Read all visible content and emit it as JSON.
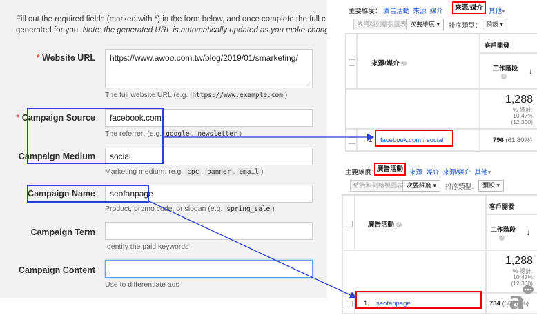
{
  "form": {
    "intro_line1": "Fill out the required fields (marked with *) in the form below, and once complete the full c",
    "intro_line2_a": "generated for you. ",
    "intro_line2_note": "Note: the generated URL is automatically updated as you make change",
    "required_mark": "*",
    "website_url": {
      "label": "Website URL",
      "value": "https://www.awoo.com.tw/blog/2019/01/smarketing/",
      "hint_prefix": "The full website URL (e.g. ",
      "hint_code": "https://www.example.com",
      "hint_suffix": ")"
    },
    "campaign_source": {
      "label": "Campaign Source",
      "value": "facebook.com",
      "hint_prefix": "The referrer: (e.g. ",
      "hint_code1": "google",
      "hint_sep": ", ",
      "hint_code2": "newsletter",
      "hint_suffix": ")"
    },
    "campaign_medium": {
      "label": "Campaign Medium",
      "value": "social",
      "hint_prefix": "Marketing medium: (e.g. ",
      "hint_code1": "cpc",
      "hint_code2": "banner",
      "hint_code3": "email",
      "hint_sep": ", ",
      "hint_suffix": ")"
    },
    "campaign_name": {
      "label": "Campaign Name",
      "value": "seofanpage",
      "hint_prefix": "Product, promo code, or slogan (e.g. ",
      "hint_code": "spring_sale",
      "hint_suffix": ")"
    },
    "campaign_term": {
      "label": "Campaign Term",
      "value": "",
      "hint": "Identify the paid keywords"
    },
    "campaign_content": {
      "label": "Campaign Content",
      "value": "",
      "hint": "Use to differentiate ads"
    }
  },
  "ga_top": {
    "primary_dim_label": "主要維度：",
    "dims": [
      "廣告活動",
      "來源",
      "媒介",
      "來源/媒介",
      "其他"
    ],
    "active_dim": "來源/媒介",
    "other_caret": "▾",
    "plot_rows": "依資料列繪製圖表",
    "secondary_dim": "次要維度",
    "caret": "▾",
    "sort_type_label": "排序類型：",
    "sort_default": "預設",
    "column_header": "來源/媒介",
    "metric_group": "客戶開發",
    "metric_name": "工作階段",
    "sort_arrow": "↓",
    "total_value": "1,288",
    "total_pct_label": "% 總計:",
    "total_pct": "10.47%",
    "total_paren": "(12,300)",
    "row_index": "1.",
    "row_label": "facebook.com / social",
    "row_value": "796",
    "row_pct": "(61.80%)"
  },
  "ga_bottom": {
    "primary_dim_label": "主要維度：",
    "dims": [
      "廣告活動",
      "來源",
      "媒介",
      "來源/媒介",
      "其他"
    ],
    "active_dim": "廣告活動",
    "other_caret": "▾",
    "plot_rows": "依資料列繪製圖表",
    "secondary_dim": "次要維度",
    "caret": "▾",
    "sort_type_label": "排序類型：",
    "sort_default": "預設",
    "column_header": "廣告活動",
    "metric_group": "客戶開發",
    "metric_name": "工作階段",
    "sort_arrow": "↓",
    "total_value": "1,288",
    "total_pct_label": "% 總計:",
    "total_pct": "10.47%",
    "total_paren": "(12,300)",
    "row_index": "1.",
    "row_label": "seofanpage",
    "row_value": "784",
    "row_pct": "(60.87%)"
  },
  "colors": {
    "blue_box": "#2b3fd6",
    "red_box": "#e00000",
    "link": "#1a55c8",
    "required": "#d9534f"
  }
}
